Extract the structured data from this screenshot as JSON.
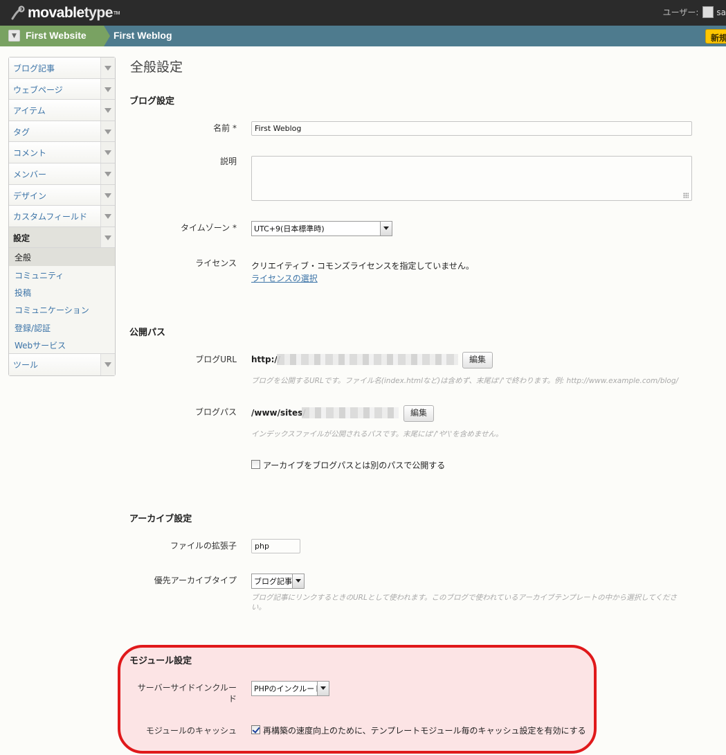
{
  "header": {
    "logo_main": "movable",
    "logo_type": "type",
    "logo_tm": "TM",
    "user_label": "ユーザー:",
    "user_name": "sa"
  },
  "breadcrumb": {
    "website": "First Website",
    "blog": "First Weblog",
    "new_button": "新規"
  },
  "sidebar": {
    "items": [
      {
        "label": "ブログ記事"
      },
      {
        "label": "ウェブページ"
      },
      {
        "label": "アイテム"
      },
      {
        "label": "タグ"
      },
      {
        "label": "コメント"
      },
      {
        "label": "メンバー"
      },
      {
        "label": "デザイン"
      },
      {
        "label": "カスタムフィールド"
      },
      {
        "label": "設定"
      },
      {
        "label": "ツール"
      }
    ],
    "settings_sub": [
      {
        "label": "全般"
      },
      {
        "label": "コミュニティ"
      },
      {
        "label": "投稿"
      },
      {
        "label": "コミュニケーション"
      },
      {
        "label": "登録/認証"
      },
      {
        "label": "Webサービス"
      }
    ]
  },
  "page": {
    "title": "全般設定"
  },
  "blog_settings": {
    "heading": "ブログ設定",
    "name_label": "名前 *",
    "name_value": "First Weblog",
    "desc_label": "説明",
    "desc_value": "",
    "tz_label": "タイムゾーン *",
    "tz_value": "UTC+9(日本標準時)",
    "license_label": "ライセンス",
    "license_text": "クリエイティブ・コモンズライセンスを指定していません。",
    "license_link": "ライセンスの選択"
  },
  "publish_paths": {
    "heading": "公開パス",
    "url_label": "ブログURL",
    "url_prefix": "http://",
    "url_edit": "編集",
    "url_hint": "ブログを公開するURLです。ファイル名(index.htmlなど)は含めず、末尾は'/'で終わります。例: http://www.example.com/blog/",
    "path_label": "ブログパス",
    "path_prefix": "/www/sites/",
    "path_edit": "編集",
    "path_hint": "インデックスファイルが公開されるパスです。末尾には'/'や'\\'を含めません。",
    "archive_cb_label": "アーカイブをブログパスとは別のパスで公開する",
    "archive_cb_checked": false
  },
  "archive_settings": {
    "heading": "アーカイブ設定",
    "ext_label": "ファイルの拡張子",
    "ext_value": "php",
    "pref_label": "優先アーカイブタイプ",
    "pref_value": "ブログ記事",
    "pref_hint_1": "ブログ記事にリンクするときのURLとして使われます。このブログで使われているアーカイブテンプレートの中から選択してくださ",
    "pref_hint_2": "い。"
  },
  "module_settings": {
    "heading": "モジュール設定",
    "ssi_label_1": "サーバーサイドインクルー",
    "ssi_label_2": "ド",
    "ssi_value": "PHPのインクルード",
    "cache_label": "モジュールのキャッシュ",
    "cache_cb_label": "再構築の速度向上のために、テンプレートモジュール毎のキャッシュ設定を有効にする",
    "cache_cb_checked": true
  },
  "colors": {
    "header_bg": "#2b2b2b",
    "crumb_site": "#79a262",
    "crumb_blog": "#4e7b8e",
    "link": "#3b73a7",
    "new_button": "#ffc600",
    "highlight_border": "#e0191b"
  }
}
